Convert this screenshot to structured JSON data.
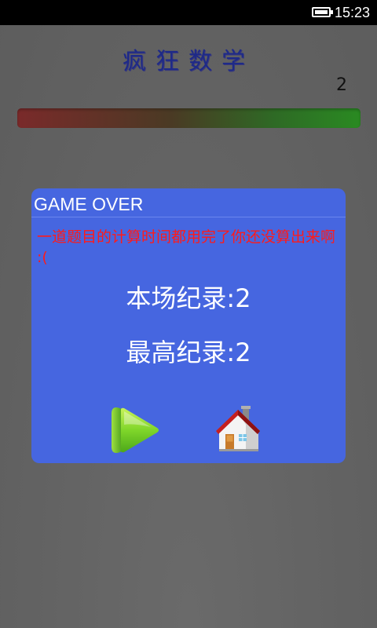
{
  "status_bar": {
    "time": "15:23",
    "battery_icon": "battery-icon"
  },
  "app": {
    "title": "疯狂数学",
    "score": "2"
  },
  "timer": {
    "level": 1.0,
    "colors": {
      "start": "#7a2a2a",
      "end": "#2a8a22"
    }
  },
  "dialog": {
    "title": "GAME OVER",
    "message": " 一道题目的计算时间都用完了你还没算出来啊 :(",
    "current_record": "本场纪录:2",
    "best_record": "最高纪录:2",
    "play_icon": "play-icon",
    "home_icon": "home-icon",
    "background": "#4666e0",
    "message_color": "#ff1a1a"
  }
}
